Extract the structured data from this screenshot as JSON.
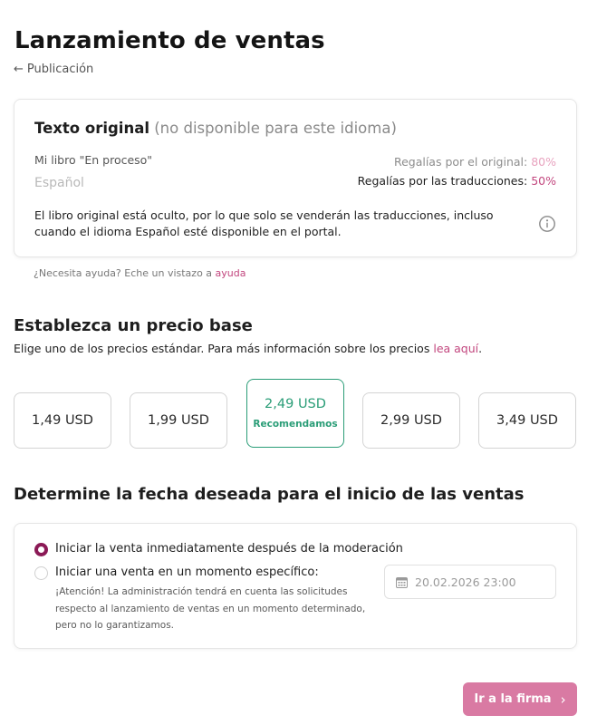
{
  "page": {
    "title": "Lanzamiento de ventas",
    "back_label": "Publicación"
  },
  "original": {
    "title_strong": "Texto original",
    "title_muted": "(no disponible para este idioma)",
    "book_name": "Mi libro \"En proceso\"",
    "language": "Español",
    "royalty_original_label": "Regalías por el original:",
    "royalty_original_value": "80%",
    "royalty_translation_label": "Regalías por las traducciones:",
    "royalty_translation_value": "50%",
    "note": "El libro original está oculto, por lo que solo se venderán las traducciones, incluso cuando el idioma Español esté disponible en el portal.",
    "info_icon": "info-circle-icon"
  },
  "help": {
    "text": "¿Necesita ayuda? Eche un vistazo a",
    "link": "ayuda"
  },
  "pricing": {
    "title": "Establezca un precio base",
    "subtitle": "Elige uno de los precios estándar. Para más información sobre los precios",
    "subtitle_link": "lea aquí",
    "subtitle_end": ".",
    "options": [
      {
        "label": "1,49 USD"
      },
      {
        "label": "1,99 USD"
      },
      {
        "label": "2,49 USD",
        "badge": "Recomendamos"
      },
      {
        "label": "2,99 USD"
      },
      {
        "label": "3,49 USD"
      }
    ],
    "recommended_color": "#2a9d77"
  },
  "schedule": {
    "title": "Determine la fecha deseada para el inicio de las ventas",
    "option_immediate": "Iniciar la venta inmediatamente después de la moderación",
    "option_specific": "Iniciar una venta en un momento específico:",
    "attention": "¡Atención! La administración tendrá en cuenta las solicitudes respecto al lanzamiento de ventas en un momento determinado, pero no lo garantizamos.",
    "date_value": "20.02.2026 23:00",
    "selected": "immediate",
    "accent_color": "#8b1a56"
  },
  "footer": {
    "next_label": "Ir a la firma",
    "next_color": "#d97aa3"
  }
}
